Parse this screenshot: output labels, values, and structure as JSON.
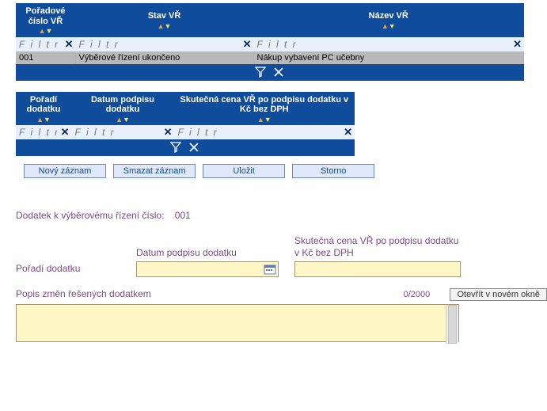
{
  "table1": {
    "headers": [
      "Pořadové číslo VŘ",
      "Stav VŘ",
      "Název VŘ"
    ],
    "filter_placeholder": "F i l t r",
    "row": {
      "cislo": "001",
      "stav": "Výběrové řízení ukončeno",
      "nazev": "Nákup vybavení PC učebny"
    }
  },
  "table2": {
    "headers": [
      "Pořadí dodatku",
      "Datum podpisu dodatku",
      "Skutečná cena VŘ po podpisu dodatku v Kč bez DPH"
    ],
    "filter_placeholder": "F i l t r"
  },
  "buttons": {
    "novy": "Nový záznam",
    "smazat": "Smazat záznam",
    "ulozit": "Uložit",
    "storno": "Storno"
  },
  "form": {
    "title_label": "Dodatek k výběrovému řízení číslo:",
    "title_num": "001",
    "poradi_label": "Pořadí dodatku",
    "datum_label": "Datum podpisu dodatku",
    "cena_label": "Skutečná cena VŘ po podpisu dodatku v Kč bez DPH",
    "popis_label": "Popis změn řešených dodatkem",
    "counter": "0/2000",
    "open_label": "Otevřít v novém okně"
  }
}
